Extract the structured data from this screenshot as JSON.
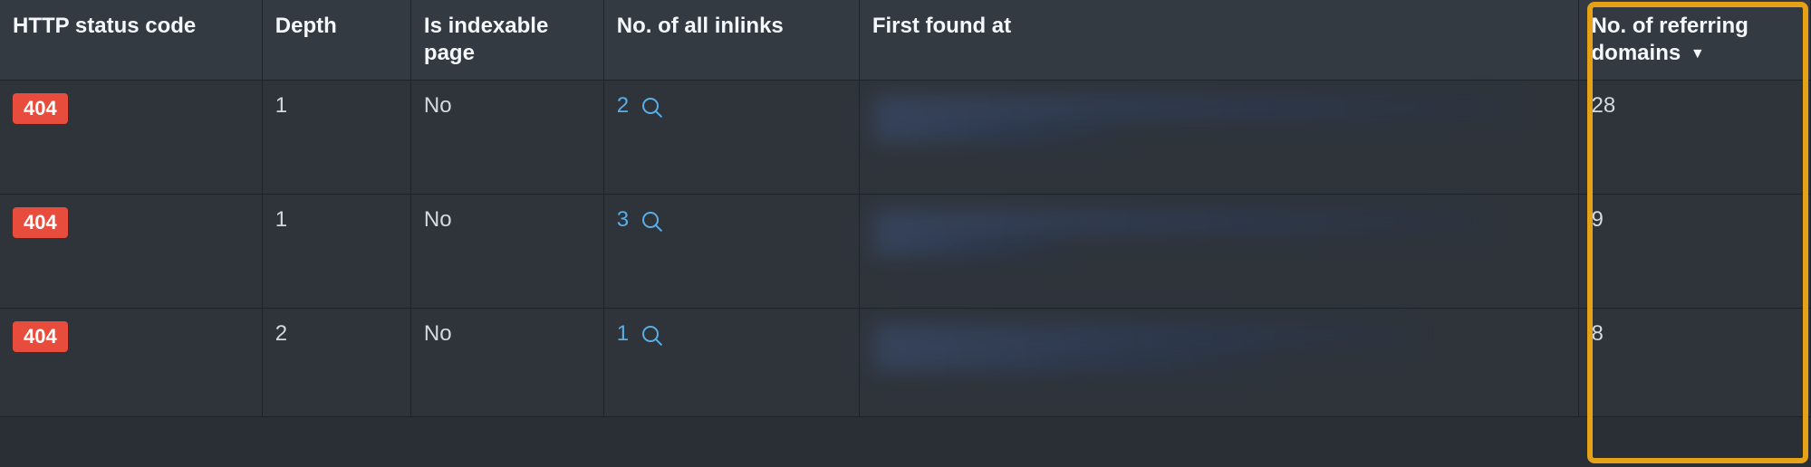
{
  "columns": {
    "status": "HTTP status code",
    "depth": "Depth",
    "indexable": "Is indexable page",
    "inlinks": "No. of all inlinks",
    "found": "First found at",
    "refdomains": "No. of referring domains",
    "sort_indicator": "▼"
  },
  "rows": [
    {
      "status": "404",
      "depth": "1",
      "indexable": "No",
      "inlinks": "2",
      "refdomains": "28"
    },
    {
      "status": "404",
      "depth": "1",
      "indexable": "No",
      "inlinks": "3",
      "refdomains": "9"
    },
    {
      "status": "404",
      "depth": "2",
      "indexable": "No",
      "inlinks": "1",
      "refdomains": "8"
    }
  ],
  "status_color": "#e74c3c",
  "highlight_color": "#e6a117",
  "link_color": "#5aaee6"
}
